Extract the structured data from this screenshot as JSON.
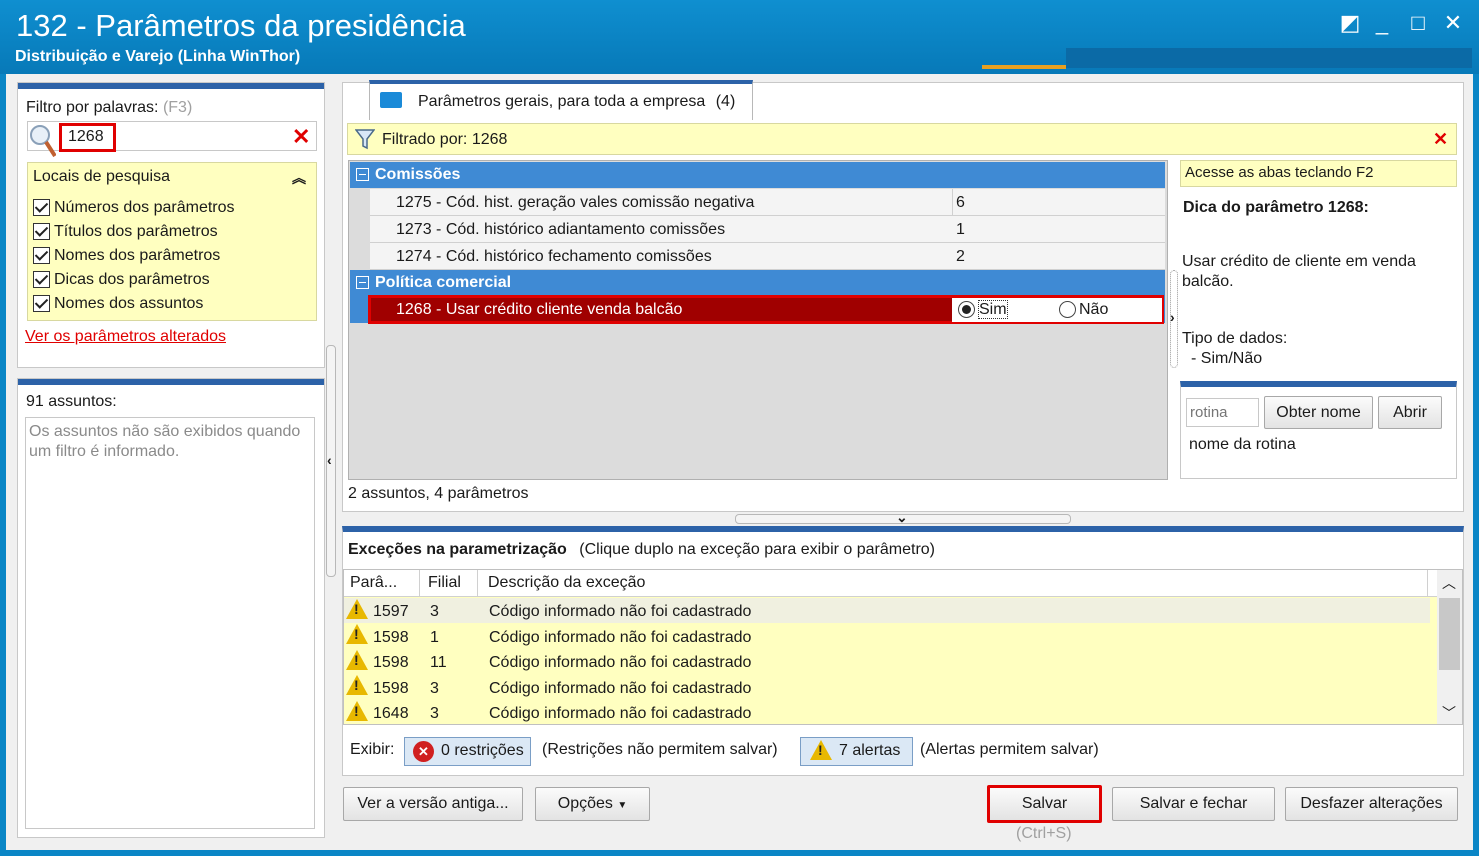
{
  "window": {
    "title": "132 - Parâmetros da presidência",
    "subtitle": "Distribuição e Varejo (Linha WinThor)",
    "controls": [
      "◩",
      "_",
      "□",
      "✕"
    ]
  },
  "left": {
    "filter_label": "Filtro por palavras:",
    "filter_shortcut": "(F3)",
    "filter_value": "1268",
    "locais_title": "Locais de pesquisa",
    "locais": [
      "Números dos parâmetros",
      "Títulos dos parâmetros",
      "Nomes dos parâmetros",
      "Dicas dos parâmetros",
      "Nomes dos assuntos"
    ],
    "changed_link": "Ver os parâmetros alterados",
    "assuntos_count": "91 assuntos:",
    "assuntos_msg": "Os assuntos não são exibidos quando um filtro é informado."
  },
  "tab": {
    "label": "Parâmetros gerais, para toda a empresa",
    "count": "(4)"
  },
  "filterbar": {
    "text": "Filtrado por: 1268"
  },
  "groups": [
    {
      "name": "Comissões",
      "rows": [
        {
          "label": "1275 - Cód. hist. geração vales comissão negativa",
          "value": "6"
        },
        {
          "label": "1273 - Cód. histórico adiantamento comissões",
          "value": "1"
        },
        {
          "label": "1274 - Cód. histórico fechamento comissões",
          "value": "2"
        }
      ]
    },
    {
      "name": "Política comercial",
      "rows": [
        {
          "label": "1268 - Usar crédito cliente venda balcão",
          "opt_yes": "Sim",
          "opt_no": "Não",
          "selected": "Sim"
        }
      ]
    }
  ],
  "grid_footer": "2 assuntos, 4 parâmetros",
  "tips": {
    "hint": "Acesse as abas teclando F2",
    "title": "Dica do parâmetro 1268:",
    "desc": "Usar crédito de cliente em venda balcão.",
    "type_label": "Tipo de dados:",
    "type_value": "- Sim/Não",
    "rotina_placeholder": "rotina",
    "obter_btn": "Obter nome",
    "abrir_btn": "Abrir",
    "rotina_caption": "nome da rotina"
  },
  "exceptions": {
    "title": "Exceções na parametrização",
    "subtitle": "(Clique duplo na exceção para exibir o parâmetro)",
    "columns": [
      "Parâ...",
      "Filial",
      "Descrição da exceção"
    ],
    "rows": [
      {
        "param": "1597",
        "filial": "3",
        "desc": "Código informado não foi cadastrado"
      },
      {
        "param": "1598",
        "filial": "1",
        "desc": "Código informado não foi cadastrado"
      },
      {
        "param": "1598",
        "filial": "11",
        "desc": "Código informado não foi cadastrado"
      },
      {
        "param": "1598",
        "filial": "3",
        "desc": "Código informado não foi cadastrado"
      },
      {
        "param": "1648",
        "filial": "3",
        "desc": "Código informado não foi cadastrado"
      }
    ],
    "show_label": "Exibir:",
    "restrictions_btn": "0 restrições",
    "restrictions_note": "(Restrições não permitem salvar)",
    "alerts_btn": "7 alertas",
    "alerts_note": "(Alertas permitem salvar)"
  },
  "footer": {
    "old_version": "Ver a versão antiga...",
    "options": "Opções",
    "save": "Salvar",
    "save_shortcut": "(Ctrl+S)",
    "save_close": "Salvar e fechar",
    "undo": "Desfazer alterações"
  },
  "colors": {
    "titlebar": "#0a86c6",
    "group_header": "#3f8ad4",
    "selected_row": "#a00000",
    "highlight": "#e00000",
    "yellow_panel": "#ffffc0"
  }
}
